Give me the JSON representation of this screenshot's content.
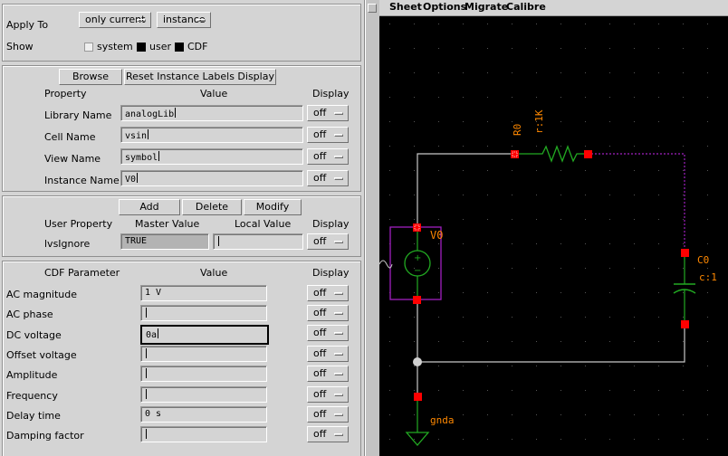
{
  "apply": {
    "label": "Apply To",
    "scope": "only current",
    "target": "instance"
  },
  "show": {
    "label": "Show",
    "options": [
      "system",
      "user",
      "CDF"
    ]
  },
  "instance_section": {
    "browse_label": "Browse",
    "reset_label": "Reset Instance Labels Display",
    "header_property": "Property",
    "header_value": "Value",
    "header_display": "Display",
    "rows": [
      {
        "label": "Library Name",
        "value": "analogLib",
        "display": "off"
      },
      {
        "label": "Cell Name",
        "value": "vsin",
        "display": "off"
      },
      {
        "label": "View Name",
        "value": "symbol",
        "display": "off"
      },
      {
        "label": "Instance Name",
        "value": "V0",
        "display": "off"
      }
    ]
  },
  "user_section": {
    "add_label": "Add",
    "delete_label": "Delete",
    "modify_label": "Modify",
    "header_property": "User Property",
    "header_master": "Master Value",
    "header_local": "Local Value",
    "header_display": "Display",
    "row": {
      "label": "lvsIgnore",
      "master": "TRUE",
      "local": "",
      "display": "off"
    }
  },
  "cdf_section": {
    "header_param": "CDF Parameter",
    "header_value": "Value",
    "header_display": "Display",
    "rows": [
      {
        "label": "AC magnitude",
        "value": "1 V",
        "display": "off"
      },
      {
        "label": "AC phase",
        "value": "",
        "display": "off"
      },
      {
        "label": "DC voltage",
        "value": "0a",
        "display": "off"
      },
      {
        "label": "Offset voltage",
        "value": "",
        "display": "off"
      },
      {
        "label": "Amplitude",
        "value": "",
        "display": "off"
      },
      {
        "label": "Frequency",
        "value": "",
        "display": "off"
      },
      {
        "label": "Delay time",
        "value": "0 s",
        "display": "off"
      },
      {
        "label": "Damping factor",
        "value": "",
        "display": "off"
      }
    ]
  },
  "menubar": [
    "Sheet",
    "Options",
    "Migrate",
    "Calibre"
  ],
  "schematic": {
    "resistor_name": "R0",
    "resistor_value": "r:1K",
    "source_name": "V0",
    "cap_name": "C0",
    "cap_value": "c:1",
    "ground_label": "gnda"
  },
  "colors": {
    "canvas": "#000000",
    "wire": "#c8c8c8",
    "pin": "#ff0000",
    "resistor": "#22aa22",
    "label": "#ff8800",
    "selection": "#a020c0",
    "grid": "#555555"
  }
}
